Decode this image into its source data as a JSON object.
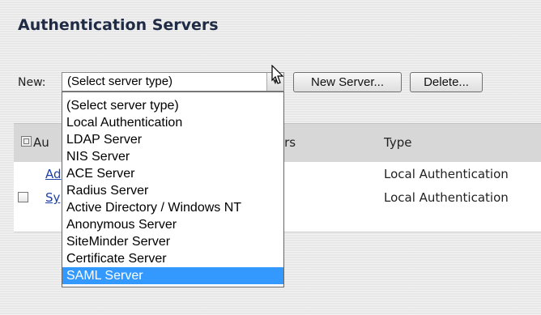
{
  "page": {
    "title": "Authentication Servers"
  },
  "toolbar": {
    "new_label": "New:",
    "select_value": "(Select server type)",
    "new_server_label": "New Server...",
    "delete_label": "Delete..."
  },
  "dropdown": {
    "options": [
      "(Select server type)",
      "Local Authentication",
      "LDAP Server",
      "NIS Server",
      "ACE Server",
      "Radius Server",
      "Active Directory / Windows NT",
      "Anonymous Server",
      "SiteMinder Server",
      "Certificate Server",
      "SAML Server"
    ],
    "highlighted": "SAML Server"
  },
  "table": {
    "headers": {
      "col1_partial": "Au",
      "col2_partial": "vers",
      "type": "Type"
    },
    "rows": [
      {
        "name_partial": "Ad",
        "type": "Local Authentication"
      },
      {
        "name_partial": "Sy",
        "type": "Local Authentication"
      }
    ]
  }
}
